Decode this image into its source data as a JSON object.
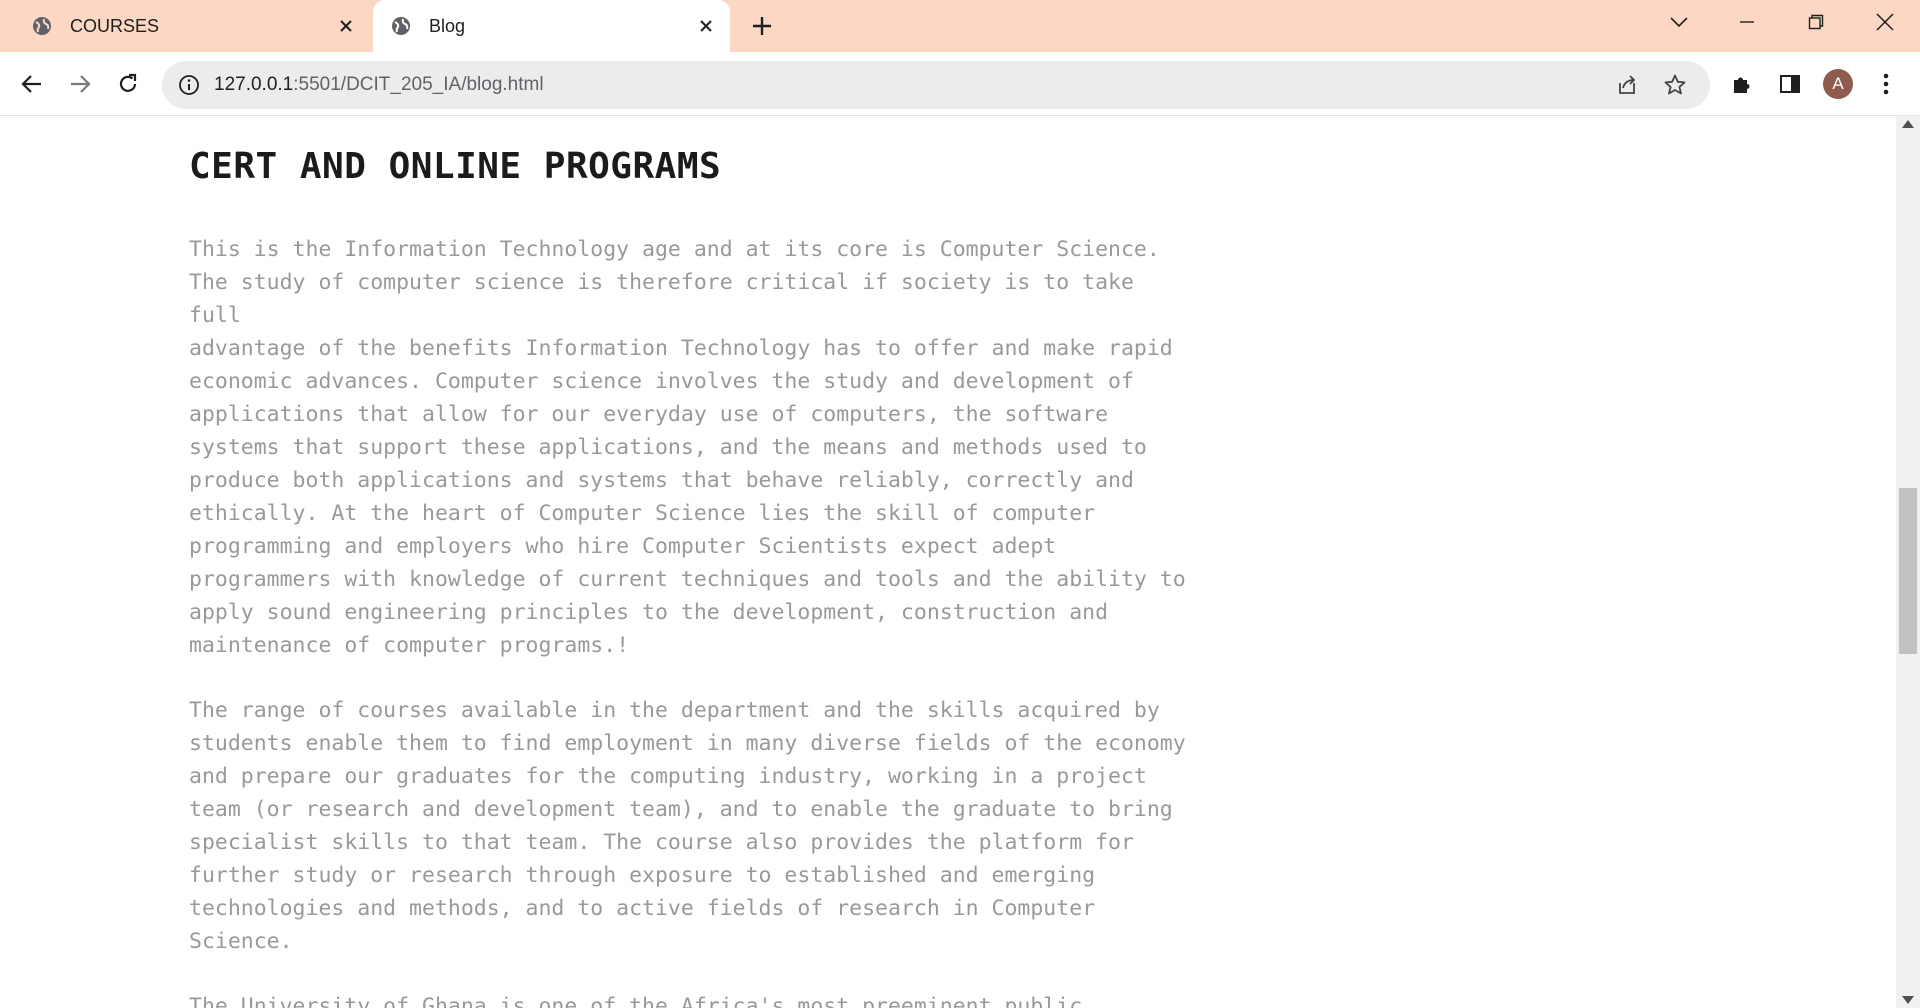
{
  "browser": {
    "tabs": [
      {
        "title": "COURSES",
        "icon": "globe-icon",
        "active": false
      },
      {
        "title": "Blog",
        "icon": "globe-icon",
        "active": true
      }
    ],
    "url_host": "127.0.0.1",
    "url_path": ":5501/DCIT_205_IA/blog.html",
    "profile_initial": "A",
    "tabbar_color": "#fcd7c3"
  },
  "page": {
    "heading": "CERT AND ONLINE PROGRAMS",
    "paragraph1": "This is the Information Technology age and at its core is Computer Science.\nThe study of computer science is therefore critical if society is to take full\nadvantage of the benefits Information Technology has to offer and make rapid\neconomic advances. Computer science involves the study and development of\napplications that allow for our everyday use of computers, the software\nsystems that support these applications, and the means and methods used to\nproduce both applications and systems that behave reliably, correctly and\nethically. At the heart of Computer Science lies the skill of computer\nprogramming and employers who hire Computer Scientists expect adept\nprogrammers with knowledge of current techniques and tools and the ability to\napply sound engineering principles to the development, construction and\nmaintenance of computer programs.!",
    "paragraph2": "The range of courses available in the department and the skills acquired by\nstudents enable them to find employment in many diverse fields of the economy\nand prepare our graduates for the computing industry, working in a project\nteam (or research and development team), and to enable the graduate to bring\nspecialist skills to that team. The course also provides the platform for\nfurther study or research through exposure to established and emerging\ntechnologies and methods, and to active fields of research in Computer\nScience.",
    "paragraph3": "The University of Ghana is one of the Africa's most preeminent public\nuniversities. Our impact on individuals, our region and the world is profound"
  }
}
